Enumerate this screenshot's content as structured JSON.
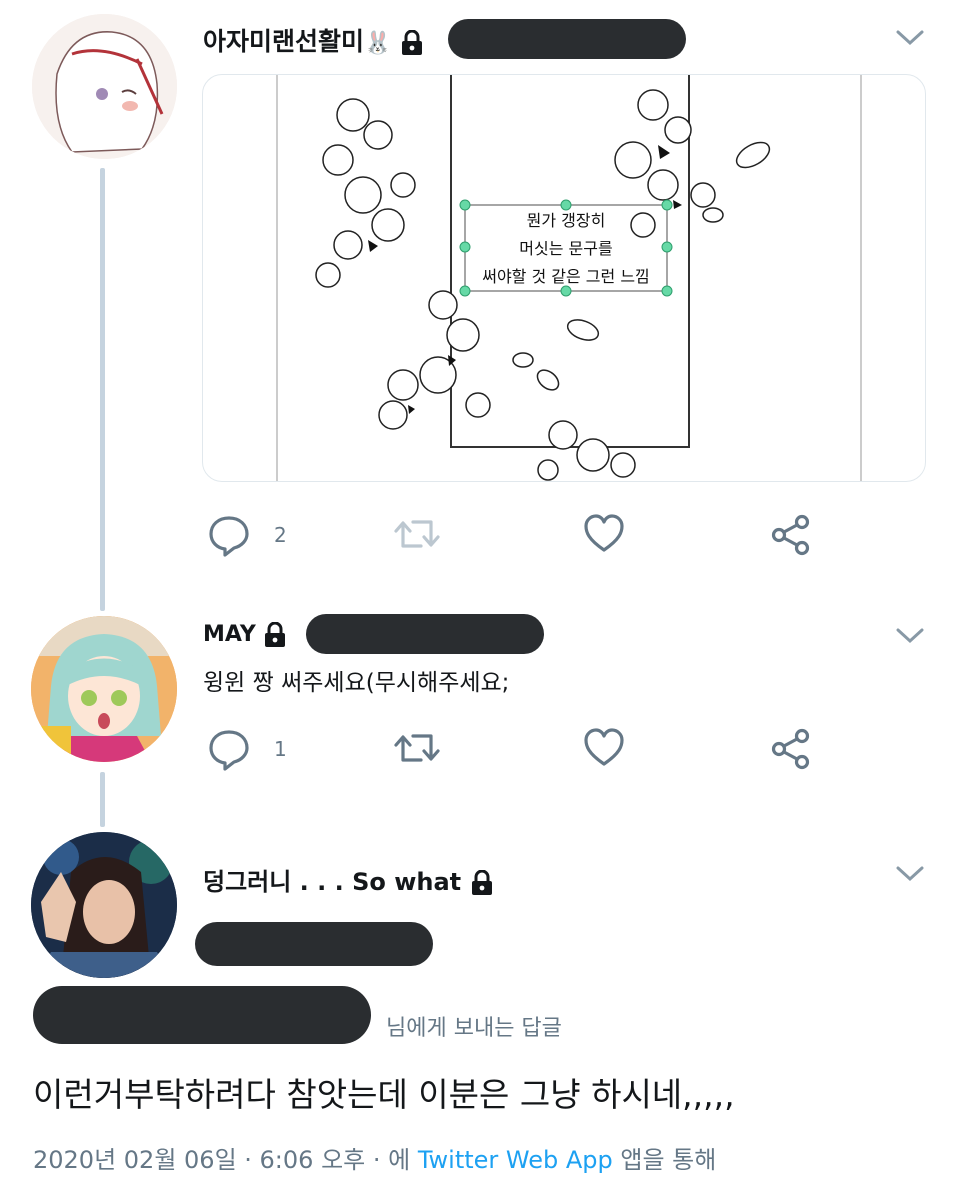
{
  "tweet1": {
    "display_name": "아자미랜선활미",
    "emoji": "🐰",
    "reply_count": "2",
    "image_text": [
      "뭔가 갱장히",
      "머싯는 문구를",
      "써야할 것 같은 그런 느낌"
    ]
  },
  "tweet2": {
    "display_name": "MAY",
    "text": "윙윈 짱 써주세요(무시해주세요;",
    "reply_count": "1"
  },
  "tweet3": {
    "display_name": "덩그러니 . . . So what",
    "reply_to_suffix": "님에게 보내는 답글",
    "text": "이런거부탁하려다 참앗는데 이분은 그냥 하시네,,,,,",
    "date": "2020년 02월 06일 · 6:06 오후 · 에",
    "client": "Twitter Web App",
    "client_suffix": "앱을 통해"
  },
  "colors": {
    "text": "#14171a",
    "secondary": "#657786",
    "link": "#1da1f2",
    "thread_line": "#c5d3df"
  },
  "icons": [
    "reply-icon",
    "retweet-icon",
    "like-icon",
    "share-icon",
    "chevron-down-icon",
    "lock-icon"
  ]
}
